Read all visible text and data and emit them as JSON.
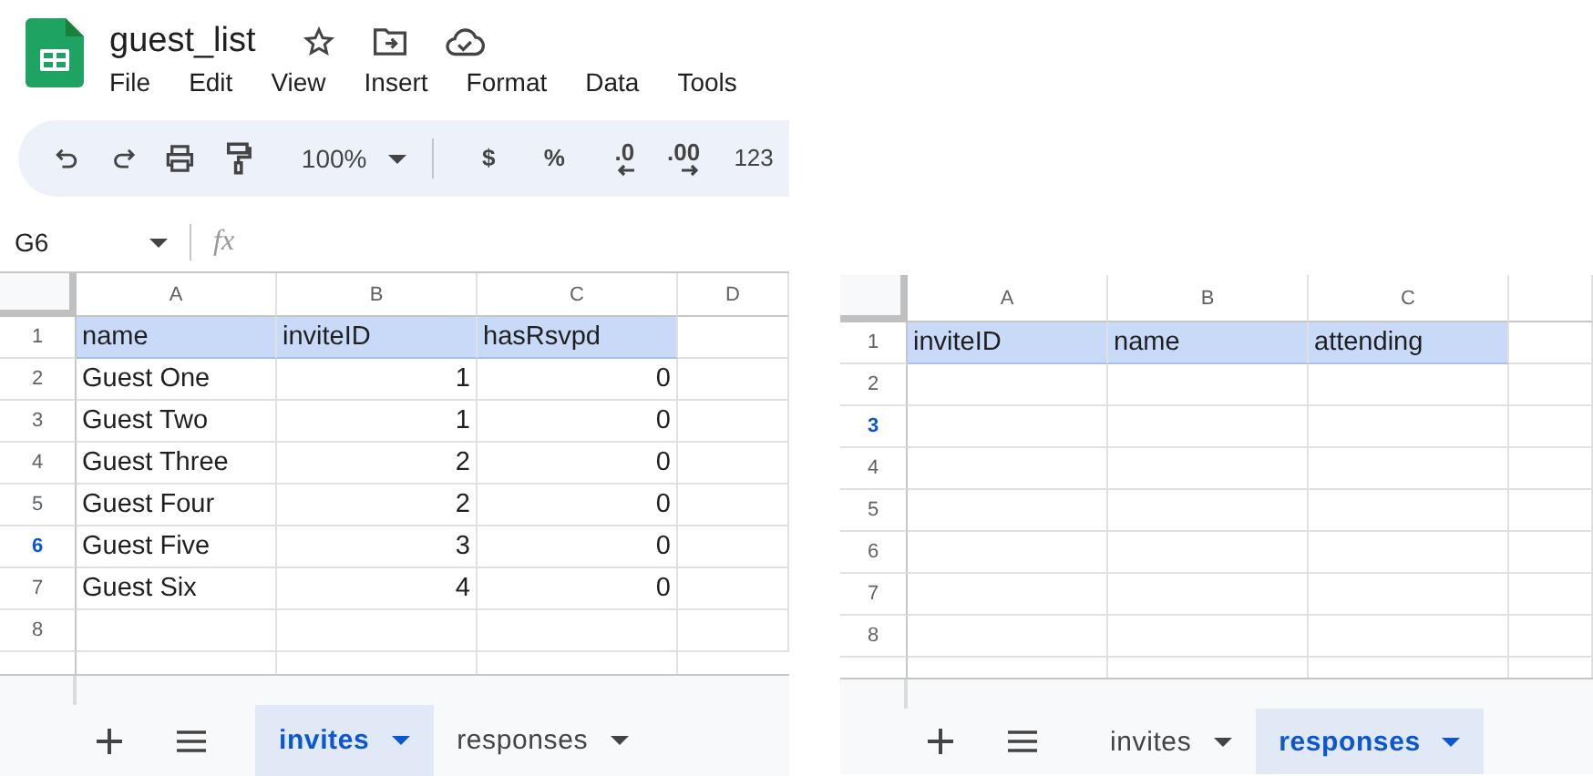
{
  "spreadsheets": [
    {
      "title": "guest_list",
      "menu": [
        "File",
        "Edit",
        "View",
        "Insert",
        "Format",
        "Data",
        "Tools"
      ],
      "toolbar": {
        "zoom": "100%",
        "formats": [
          {
            "kind": "currency",
            "text": "$"
          },
          {
            "kind": "percent",
            "text": "%"
          },
          {
            "kind": "decrease_decimals",
            "text": ".0"
          },
          {
            "kind": "increase_decimals",
            "text": ".00"
          },
          {
            "kind": "number",
            "text": "123"
          }
        ]
      },
      "name_box": "G6",
      "formula_icon": "fx",
      "columns": [
        "A",
        "B",
        "C",
        "D"
      ],
      "rows": [
        {
          "number": "1",
          "selected": false,
          "kind": "header",
          "cells": [
            {
              "text": "name",
              "kind": "text"
            },
            {
              "text": "inviteID",
              "kind": "text"
            },
            {
              "text": "hasRsvpd",
              "kind": "text"
            }
          ]
        },
        {
          "number": "2",
          "selected": false,
          "kind": "data",
          "cells": [
            {
              "text": "Guest One",
              "kind": "text"
            },
            {
              "text": "1",
              "kind": "number"
            },
            {
              "text": "0",
              "kind": "number"
            }
          ]
        },
        {
          "number": "3",
          "selected": false,
          "kind": "data",
          "cells": [
            {
              "text": "Guest Two",
              "kind": "text"
            },
            {
              "text": "1",
              "kind": "number"
            },
            {
              "text": "0",
              "kind": "number"
            }
          ]
        },
        {
          "number": "4",
          "selected": false,
          "kind": "data",
          "cells": [
            {
              "text": "Guest Three",
              "kind": "text"
            },
            {
              "text": "2",
              "kind": "number"
            },
            {
              "text": "0",
              "kind": "number"
            }
          ]
        },
        {
          "number": "5",
          "selected": false,
          "kind": "data",
          "cells": [
            {
              "text": "Guest Four",
              "kind": "text"
            },
            {
              "text": "2",
              "kind": "number"
            },
            {
              "text": "0",
              "kind": "number"
            }
          ]
        },
        {
          "number": "6",
          "selected": true,
          "kind": "data",
          "cells": [
            {
              "text": "Guest Five",
              "kind": "text"
            },
            {
              "text": "3",
              "kind": "number"
            },
            {
              "text": "0",
              "kind": "number"
            }
          ]
        },
        {
          "number": "7",
          "selected": false,
          "kind": "data",
          "cells": [
            {
              "text": "Guest Six",
              "kind": "text"
            },
            {
              "text": "4",
              "kind": "number"
            },
            {
              "text": "0",
              "kind": "number"
            }
          ]
        },
        {
          "number": "8",
          "selected": false,
          "kind": "data"
        }
      ],
      "tabs": [
        {
          "label": "invites",
          "selected": true
        },
        {
          "label": "responses",
          "selected": false
        }
      ]
    },
    {
      "columns": [
        "A",
        "B",
        "C"
      ],
      "rows": [
        {
          "number": "1",
          "selected": false,
          "kind": "header",
          "cells": [
            {
              "text": "inviteID",
              "kind": "text"
            },
            {
              "text": "name",
              "kind": "text"
            },
            {
              "text": "attending",
              "kind": "text"
            }
          ]
        },
        {
          "number": "2",
          "selected": false,
          "kind": "data"
        },
        {
          "number": "3",
          "selected": true,
          "kind": "data"
        },
        {
          "number": "4",
          "selected": false,
          "kind": "data"
        },
        {
          "number": "5",
          "selected": false,
          "kind": "data"
        },
        {
          "number": "6",
          "selected": false,
          "kind": "data"
        },
        {
          "number": "7",
          "selected": false,
          "kind": "data"
        },
        {
          "number": "8",
          "selected": false,
          "kind": "data"
        }
      ],
      "tabs": [
        {
          "label": "invites",
          "selected": false
        },
        {
          "label": "responses",
          "selected": true
        }
      ]
    }
  ]
}
